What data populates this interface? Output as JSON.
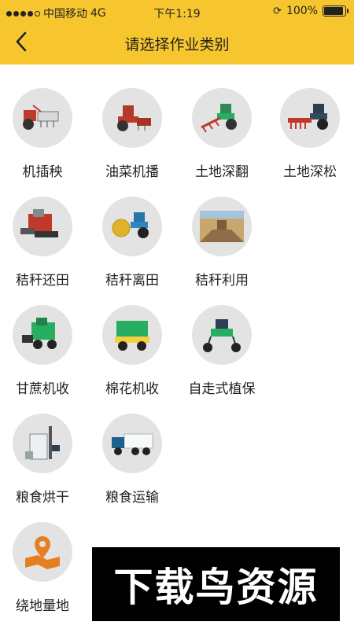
{
  "status_bar": {
    "carrier": "中国移动",
    "network": "4G",
    "time": "下午1:19",
    "battery": "100%",
    "battery_level": 1.0
  },
  "header": {
    "title": "请选择作业类别",
    "background": "#f7c62f"
  },
  "categories": [
    {
      "label": "机插秧",
      "icon": "rice-transplanter-icon"
    },
    {
      "label": "油菜机播",
      "icon": "rapeseed-seeder-icon"
    },
    {
      "label": "土地深翻",
      "icon": "deep-plough-icon"
    },
    {
      "label": "土地深松",
      "icon": "subsoiler-icon"
    },
    {
      "label": "秸秆还田",
      "icon": "straw-return-harvester-icon"
    },
    {
      "label": "秸秆离田",
      "icon": "straw-baler-icon"
    },
    {
      "label": "秸秆利用",
      "icon": "straw-utilization-icon"
    },
    {
      "label": "甘蔗机收",
      "icon": "sugarcane-harvester-icon"
    },
    {
      "label": "棉花机收",
      "icon": "cotton-harvester-icon"
    },
    {
      "label": "自走式植保",
      "icon": "self-propelled-sprayer-icon"
    },
    {
      "label": "粮食烘干",
      "icon": "grain-dryer-icon"
    },
    {
      "label": "粮食运输",
      "icon": "grain-truck-icon"
    },
    {
      "label": "绕地量地",
      "icon": "map-pin-icon"
    }
  ],
  "watermark": "下载鸟资源"
}
